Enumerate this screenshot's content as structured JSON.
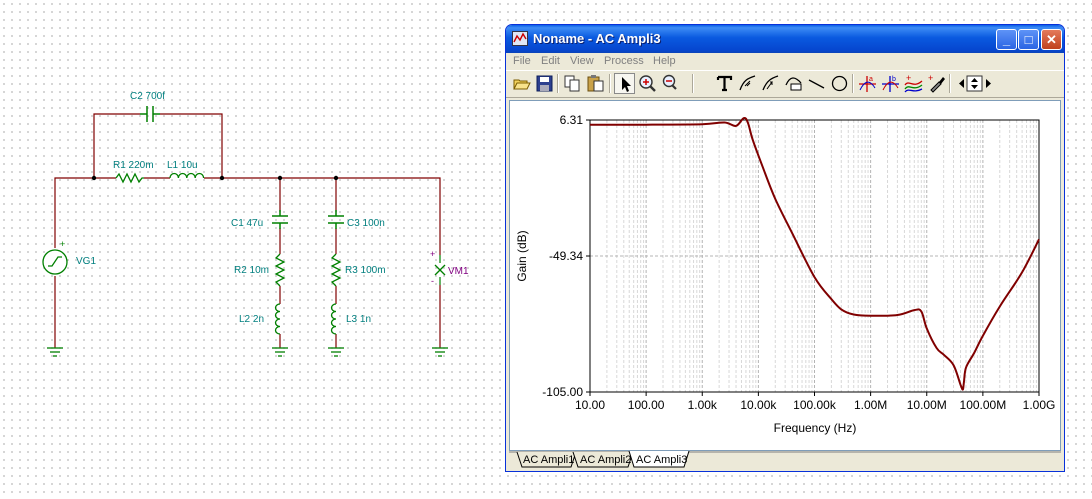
{
  "schematic": {
    "components": {
      "c2": "C2 700f",
      "r1": "R1 220m",
      "l1": "L1 10u",
      "vg1": "VG1",
      "c1": "C1 47u",
      "r2": "R2 10m",
      "l2": "L2 2n",
      "c3": "C3 100n",
      "r3": "R3 100m",
      "l3": "L3 1n",
      "vm1": "VM1"
    },
    "wire_color": "#800000",
    "component_color": "#008000"
  },
  "window": {
    "title": "Noname - AC Ampli3",
    "controls": {
      "minimize": "_",
      "maximize": "□",
      "close": "✕"
    },
    "menu": [
      "File",
      "Edit",
      "View",
      "Process",
      "Help"
    ],
    "toolbar_icons": [
      "open-folder-icon",
      "save-disk-icon",
      "copy-icon",
      "paste-icon",
      "arrow-cursor-icon",
      "zoom-in-icon",
      "zoom-100-icon",
      "text-tool-icon",
      "curve-marker-icon",
      "curve-arrow-icon",
      "curve-label-icon",
      "line-tool-icon",
      "ellipse-tool-icon",
      "cursor-a-icon",
      "cursor-b-icon",
      "add-curve-icon",
      "color-picker-icon",
      "navigate-arrows-icon"
    ],
    "tabs": [
      "AC Ampli1",
      "AC Ampli2",
      "AC Ampli3"
    ],
    "active_tab": "AC Ampli3"
  },
  "chart_data": {
    "type": "line",
    "title": "",
    "xlabel": "Frequency (Hz)",
    "ylabel": "Gain (dB)",
    "x_scale": "log",
    "xlim": [
      10,
      1000000000
    ],
    "ylim": [
      -105,
      6.31
    ],
    "x_tick_labels": [
      "10.00",
      "100.00",
      "1.00k",
      "10.00k",
      "100.00k",
      "1.00M",
      "10.00M",
      "100.00M",
      "1.00G"
    ],
    "y_tick_labels": [
      "6.31",
      "-49.34",
      "-105.00"
    ],
    "grid": true,
    "line_color": "#800000",
    "series": [
      {
        "x": [
          10,
          100,
          1000,
          2500,
          4000,
          5500,
          6500,
          8000,
          12000,
          20000,
          40000,
          100000,
          200000,
          300000,
          500000,
          1000000,
          3000000,
          6000000,
          8000000,
          10000000,
          15000000,
          20000000,
          30000000,
          40000000,
          44000000,
          46000000,
          50000000,
          70000000,
          100000000,
          200000000,
          500000000,
          1000000000
        ],
        "y": [
          4.4,
          4.4,
          4.6,
          5.3,
          3.9,
          7.1,
          5.2,
          -2.0,
          -13.0,
          -26.0,
          -40.0,
          -58.0,
          -67.0,
          -71.2,
          -73.3,
          -73.8,
          -73.5,
          -71.5,
          -72.0,
          -79.0,
          -87.0,
          -89.7,
          -94.0,
          -102.0,
          -104.0,
          -101.0,
          -95.0,
          -89.0,
          -82.0,
          -70.0,
          -56.0,
          -42.5
        ]
      }
    ]
  }
}
